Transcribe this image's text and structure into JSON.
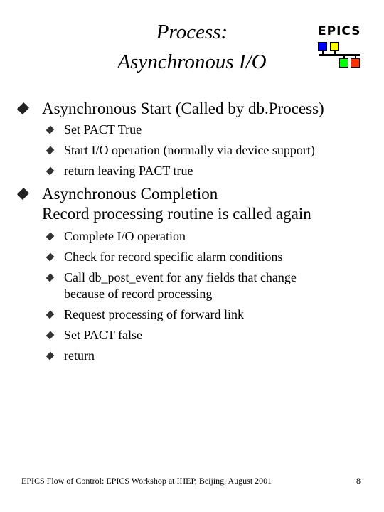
{
  "slide": {
    "title_line1": "Process:",
    "title_line2": "Asynchronous I/O",
    "logo": {
      "text": "EPICS",
      "colors": {
        "blue": "#0000ff",
        "yellow": "#ffff00",
        "green": "#00ff00",
        "red": "#ff3300"
      }
    },
    "sections": [
      {
        "heading_lines": [
          "Asynchronous Start (Called by db.Process)"
        ],
        "items": [
          "Set PACT True",
          "Start I/O operation (normally via device support)",
          "return leaving PACT true"
        ]
      },
      {
        "heading_lines": [
          "Asynchronous Completion",
          "Record processing routine is called again"
        ],
        "items": [
          "Complete I/O operation",
          "Check for record specific alarm conditions",
          [
            "Call db_post_event for any fields that change",
            "because of record processing"
          ],
          "Request processing of forward link",
          "Set PACT false",
          "return"
        ]
      }
    ],
    "footer": "EPICS Flow of Control: EPICS Workshop at IHEP, Beijing, August 2001",
    "page_number": "8"
  }
}
